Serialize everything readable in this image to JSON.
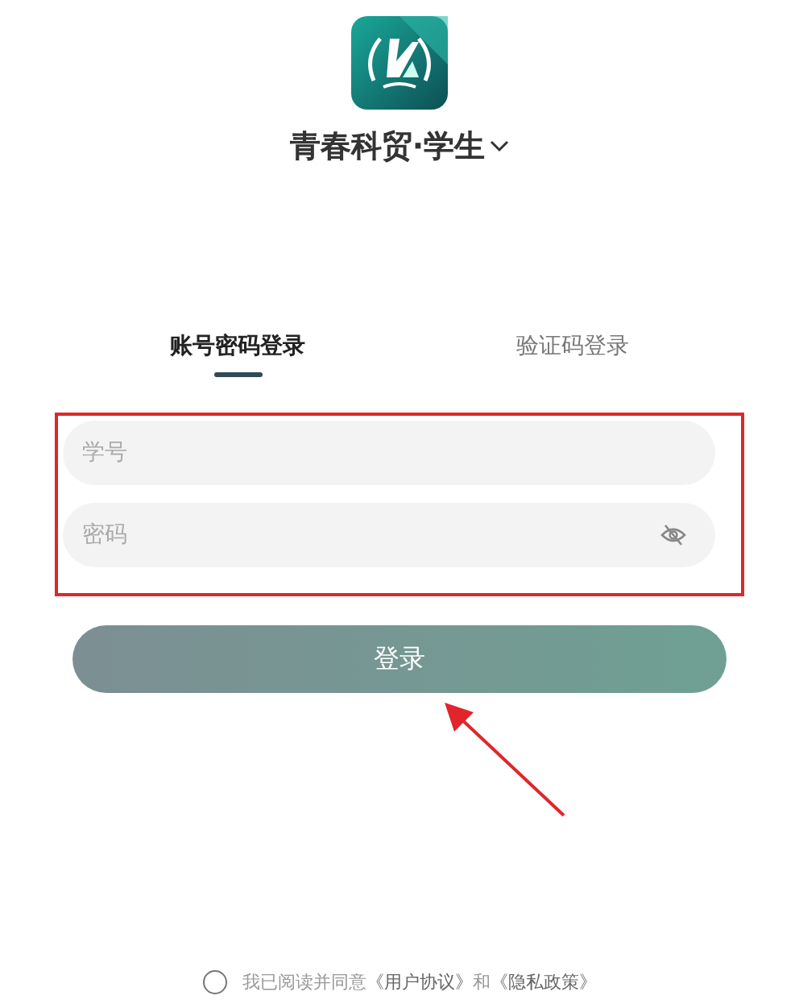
{
  "app": {
    "title": "青春科贸·学生"
  },
  "tabs": [
    {
      "label": "账号密码登录",
      "selected": true
    },
    {
      "label": "验证码登录",
      "selected": false
    }
  ],
  "fields": [
    {
      "kind": "text",
      "placeholder": "学号"
    },
    {
      "kind": "password",
      "placeholder": "密码",
      "visible": false
    }
  ],
  "login_button": "登录",
  "agreement": {
    "checked": false,
    "prefix": "我已阅读并同意",
    "links": [
      "《用户协议》",
      "《隐私政策》"
    ],
    "joiner": "和"
  }
}
